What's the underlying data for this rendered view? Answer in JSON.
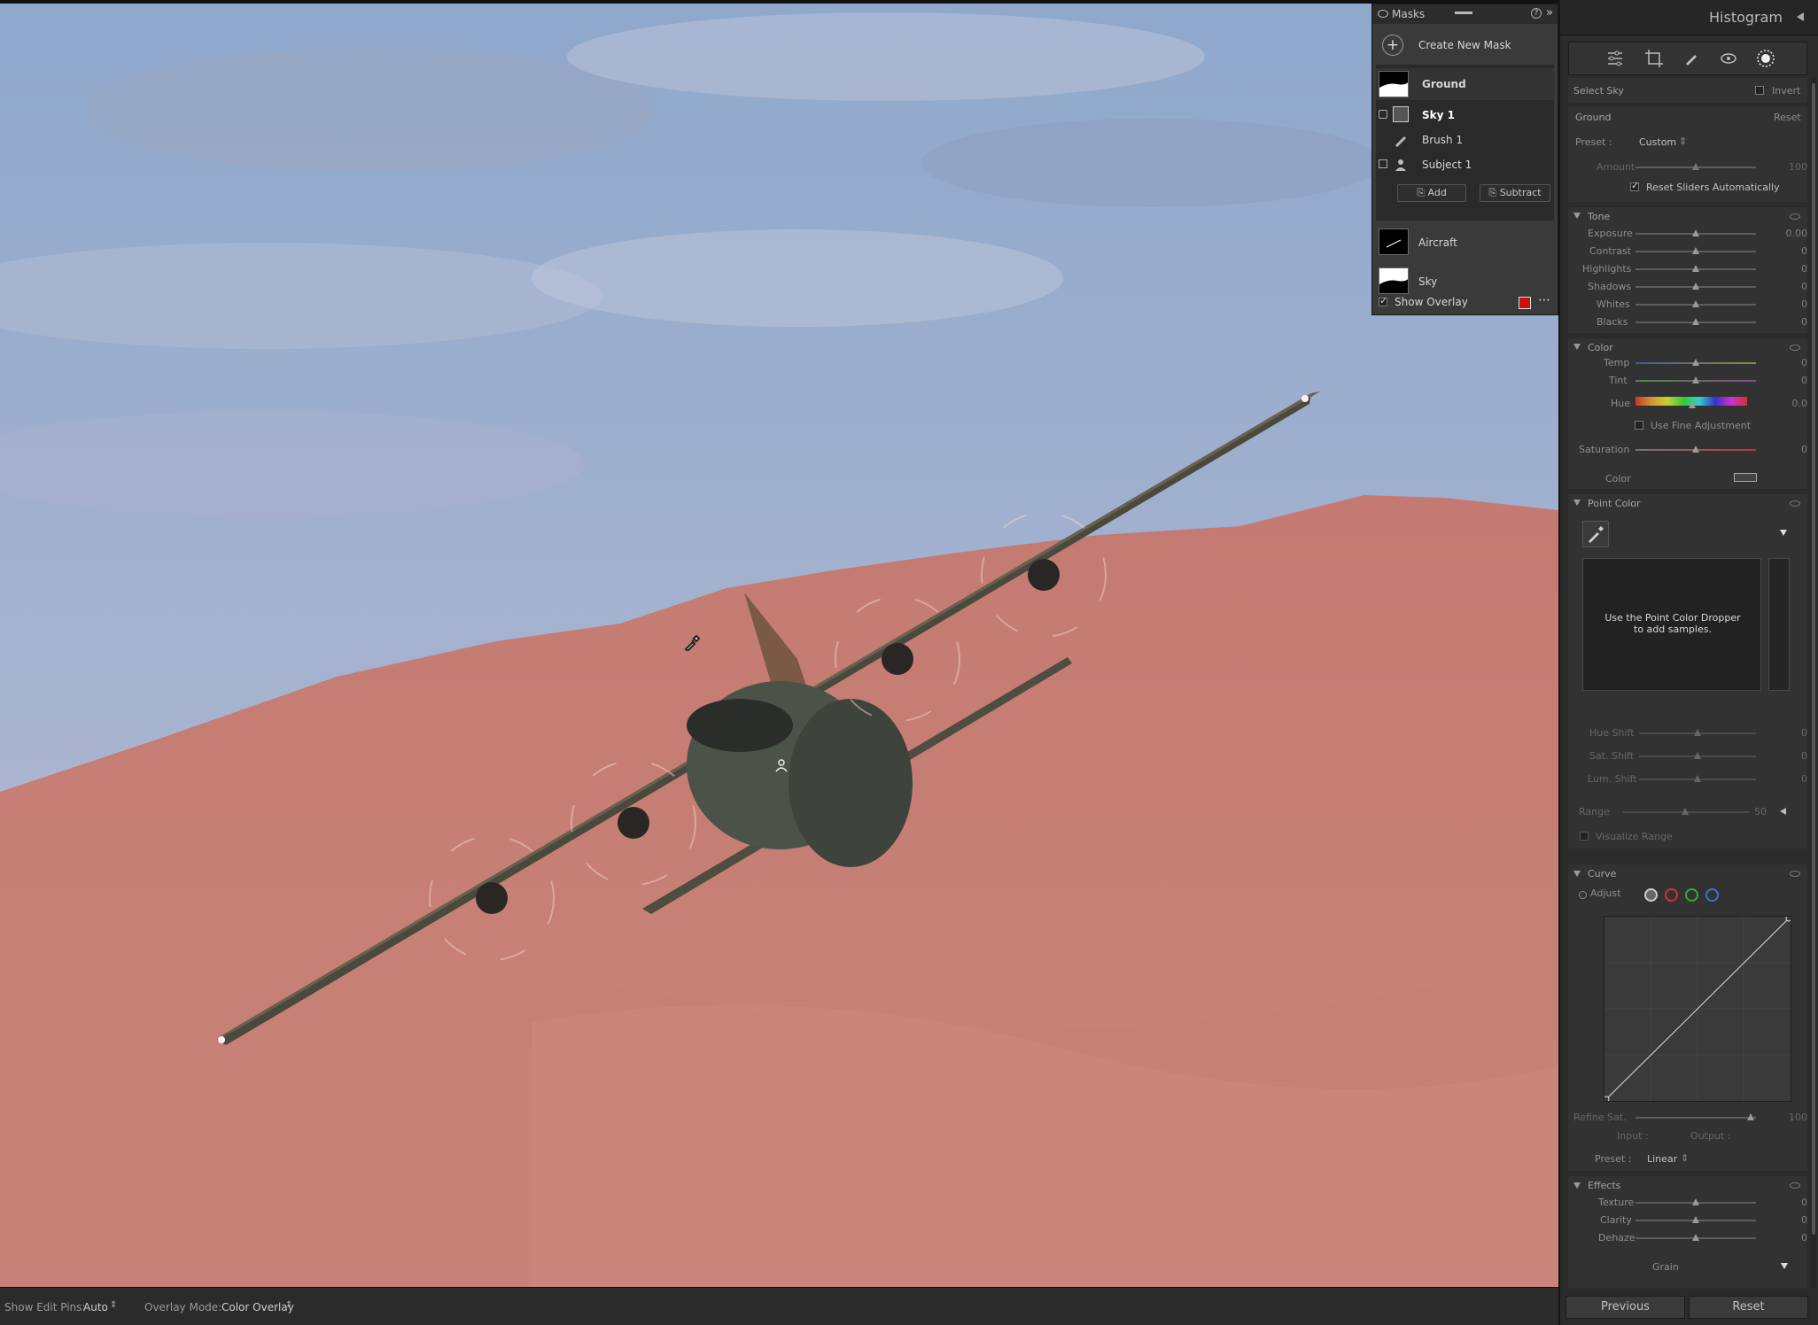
{
  "toolbar": {
    "edit_pins_label": "Show Edit Pins:",
    "edit_pins_value": "Auto",
    "overlay_mode_label": "Overlay Mode:",
    "overlay_mode_value": "Color Overlay"
  },
  "masks_panel": {
    "title": "Masks",
    "create_label": "Create New Mask",
    "items": [
      {
        "label": "Ground"
      },
      {
        "label": "Sky 1"
      },
      {
        "label": "Brush 1"
      },
      {
        "label": "Subject 1"
      }
    ],
    "add_label": "Add",
    "subtract_label": "Subtract",
    "other_masks": [
      {
        "label": "Aircraft"
      },
      {
        "label": "Sky"
      }
    ],
    "show_overlay_label": "Show Overlay",
    "overlay_color": "#cc1111"
  },
  "right_panel": {
    "histogram_title": "Histogram",
    "select_label": "Select Sky",
    "invert_label": "Invert",
    "mask_name": "Ground",
    "reset_label": "Reset",
    "preset_label": "Preset :",
    "preset_value": "Custom",
    "amount_label": "Amount",
    "amount_value": "100",
    "reset_auto_label": "Reset Sliders Automatically",
    "tone": {
      "title": "Tone",
      "sliders": [
        {
          "label": "Exposure",
          "value": "0.00"
        },
        {
          "label": "Contrast",
          "value": "0"
        },
        {
          "label": "Highlights",
          "value": "0"
        },
        {
          "label": "Shadows",
          "value": "0"
        },
        {
          "label": "Whites",
          "value": "0"
        },
        {
          "label": "Blacks",
          "value": "0"
        }
      ]
    },
    "color": {
      "title": "Color",
      "temp_label": "Temp",
      "temp_value": "0",
      "tint_label": "Tint",
      "tint_value": "0",
      "hue_label": "Hue",
      "hue_value": "0.0",
      "fine_label": "Use Fine Adjustment",
      "saturation_label": "Saturation",
      "saturation_value": "0",
      "color_label": "Color"
    },
    "point_color": {
      "title": "Point Color",
      "hint": "Use the Point Color Dropper to add samples.",
      "sliders": [
        {
          "label": "Hue Shift",
          "value": "0"
        },
        {
          "label": "Sat. Shift",
          "value": "0"
        },
        {
          "label": "Lum. Shift",
          "value": "0"
        }
      ],
      "range_label": "Range",
      "range_value": "50",
      "visualize_label": "Visualize Range"
    },
    "curve": {
      "title": "Curve",
      "adjust_label": "Adjust",
      "refine_label": "Refine Sat.",
      "refine_value": "100",
      "input_label": "Input :",
      "output_label": "Output :",
      "preset_label": "Preset :",
      "preset_value": "Linear"
    },
    "effects": {
      "title": "Effects",
      "sliders": [
        {
          "label": "Texture",
          "value": "0"
        },
        {
          "label": "Clarity",
          "value": "0"
        },
        {
          "label": "Dehaze",
          "value": "0"
        }
      ],
      "grain_label": "Grain"
    },
    "previous_label": "Previous",
    "reset_button_label": "Reset"
  }
}
